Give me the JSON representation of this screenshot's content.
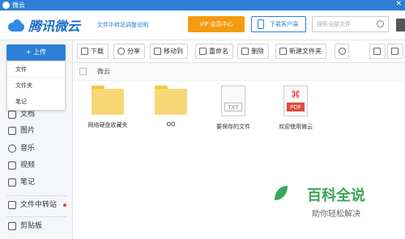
{
  "titlebar": {
    "title": "微云",
    "close": "✕"
  },
  "header": {
    "brand": "腾讯微云",
    "notice": "文件中转站调整说明",
    "vip_label": "VIP 会员中心",
    "client_label": "下载客户端",
    "search_placeholder": "搜索全部文件"
  },
  "sidebar": {
    "upload_label": "+ 上传",
    "dropdown": [
      "文件",
      "文件夹",
      "笔记"
    ],
    "items": [
      {
        "label": "文档",
        "icon": "document-icon"
      },
      {
        "label": "图片",
        "icon": "image-icon"
      },
      {
        "label": "音乐",
        "icon": "music-icon"
      },
      {
        "label": "视频",
        "icon": "video-icon"
      },
      {
        "label": "笔记",
        "icon": "note-icon"
      },
      {
        "label": "文件中转站",
        "icon": "transfer-icon"
      },
      {
        "label": "剪贴板",
        "icon": "clipboard-icon"
      }
    ]
  },
  "toolbar": {
    "buttons": [
      "下载",
      "分享",
      "移动到",
      "重命名",
      "删除",
      "新建文件夹"
    ]
  },
  "breadcrumb": "微云",
  "files": [
    {
      "name": "网络硬盘收藏夹",
      "type": "folder"
    },
    {
      "name": "QQ",
      "type": "folder"
    },
    {
      "name": "要保存的文件",
      "type": "txt",
      "label": "TXT"
    },
    {
      "name": "欢迎使用微云",
      "type": "pdf",
      "label": "PDF"
    }
  ],
  "watermark": {
    "title": "百科全说",
    "subtitle": "助你轻松解决"
  },
  "colors": {
    "accent": "#2e7fd6",
    "vip": "#f39c12",
    "folder": "#f7d774",
    "pdf": "#e04b3f",
    "watermark": "#3aa657"
  }
}
